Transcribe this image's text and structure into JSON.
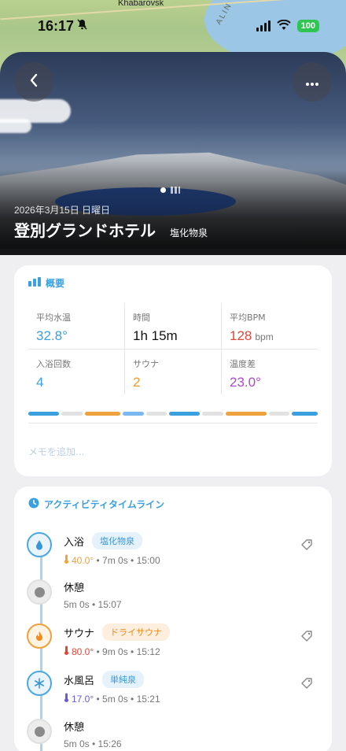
{
  "map": {
    "city": "Khabarovsk",
    "region": "ALIN"
  },
  "status_bar": {
    "time": "16:17",
    "battery": "100"
  },
  "hero": {
    "date": "2026年3月15日 日曜日",
    "title": "登別グランドホテル",
    "subtitle": "塩化物泉",
    "back_icon": "chevron-left-icon",
    "more_icon": "ellipsis-icon"
  },
  "summary": {
    "heading": "概要",
    "stats": [
      [
        {
          "label": "平均水温",
          "value": "32.8°",
          "color": "#3aa0e0"
        },
        {
          "label": "時間",
          "value": "1h 15m",
          "color": "#111111"
        },
        {
          "label": "平均BPM",
          "value": "128",
          "unit": "bpm",
          "color": "#e0473b"
        }
      ],
      [
        {
          "label": "入浴回数",
          "value": "4",
          "color": "#3aa0e0"
        },
        {
          "label": "サウナ",
          "value": "2",
          "color": "#ef9a2a"
        },
        {
          "label": "温度差",
          "value": "23.0°",
          "color": "#b048d0"
        }
      ]
    ],
    "segments": [
      {
        "weight": 3.0,
        "color": "#3aa0e0"
      },
      {
        "weight": 2.0,
        "color": "#e2e2e2"
      },
      {
        "weight": 3.5,
        "color": "#f0a23e"
      },
      {
        "weight": 2.0,
        "color": "#7ab8ef"
      },
      {
        "weight": 2.0,
        "color": "#e2e2e2"
      },
      {
        "weight": 3.0,
        "color": "#3aa0e0"
      },
      {
        "weight": 2.0,
        "color": "#e2e2e2"
      },
      {
        "weight": 4.0,
        "color": "#f0a23e"
      },
      {
        "weight": 2.0,
        "color": "#e2e2e2"
      },
      {
        "weight": 2.5,
        "color": "#3aa0e0"
      }
    ],
    "memo_placeholder": "メモを追加..."
  },
  "timeline": {
    "heading": "アクティビティタイムライン",
    "entries": [
      {
        "type": "bath",
        "name": "入浴",
        "tag": "塩化物泉",
        "tag_style": "blue",
        "temp": "40.0°",
        "temp_color": "#f0a23e",
        "detail": "7m 0s • 15:00",
        "has_tag_icon": true
      },
      {
        "type": "rest",
        "name": "休憩",
        "detail": "5m 0s • 15:07"
      },
      {
        "type": "sauna",
        "name": "サウナ",
        "tag": "ドライサウナ",
        "tag_style": "orange",
        "temp": "80.0°",
        "temp_color": "#e0473b",
        "detail": "9m 0s • 15:12",
        "has_tag_icon": true
      },
      {
        "type": "cold",
        "name": "水風呂",
        "tag": "単純泉",
        "tag_style": "blue",
        "temp": "17.0°",
        "temp_color": "#6b5cd8",
        "detail": "5m 0s • 15:21",
        "has_tag_icon": true
      },
      {
        "type": "rest",
        "name": "休憩",
        "detail": "5m 0s • 15:26"
      }
    ]
  }
}
